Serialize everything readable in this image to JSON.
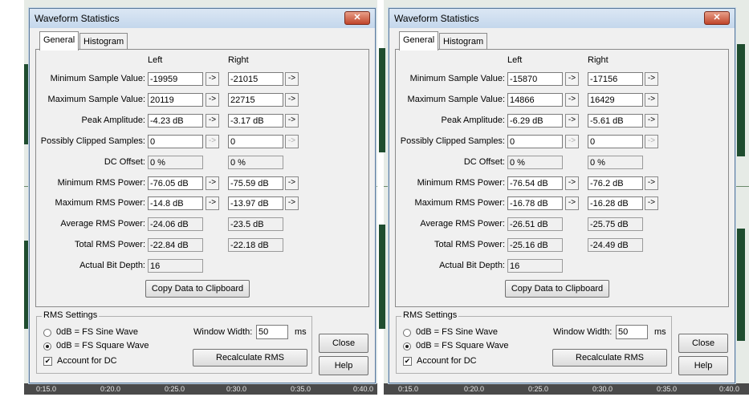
{
  "dialogs": [
    {
      "title": "Waveform Statistics",
      "close_glyph": "✕",
      "tabs": [
        "General",
        "Histogram"
      ],
      "col_left": "Left",
      "col_right": "Right",
      "rows": [
        {
          "label": "Minimum Sample Value:",
          "left": "-19959",
          "right": "-21015",
          "arrows": "on"
        },
        {
          "label": "Maximum Sample Value:",
          "left": "20119",
          "right": "22715",
          "arrows": "on"
        },
        {
          "label": "Peak Amplitude:",
          "left": "-4.23 dB",
          "right": "-3.17 dB",
          "arrows": "on"
        },
        {
          "label": "Possibly Clipped Samples:",
          "left": "0",
          "right": "0",
          "arrows": "disabled"
        },
        {
          "label": "DC Offset:",
          "left": "0 %",
          "right": "0 %",
          "arrows": "none"
        },
        {
          "label": "Minimum RMS Power:",
          "left": "-76.05 dB",
          "right": "-75.59 dB",
          "arrows": "on"
        },
        {
          "label": "Maximum RMS Power:",
          "left": "-14.8 dB",
          "right": "-13.97 dB",
          "arrows": "on"
        },
        {
          "label": "Average RMS Power:",
          "left": "-24.06 dB",
          "right": "-23.5 dB",
          "arrows": "none"
        },
        {
          "label": "Total RMS Power:",
          "left": "-22.84 dB",
          "right": "-22.18 dB",
          "arrows": "none"
        },
        {
          "label": "Actual Bit Depth:",
          "left": "16",
          "right": null,
          "arrows": "none"
        }
      ],
      "copy_button": "Copy Data to Clipboard",
      "rms_settings": {
        "title": "RMS Settings",
        "sine_label": "0dB = FS Sine Wave",
        "square_label": "0dB = FS Square Wave",
        "selected": "square",
        "dc_label": "Account for DC",
        "dc_checked": true,
        "window_width_label": "Window Width:",
        "window_width_value": "50",
        "window_width_unit": "ms",
        "recalc_button": "Recalculate RMS"
      },
      "close_button": "Close",
      "help_button": "Help"
    },
    {
      "title": "Waveform Statistics",
      "close_glyph": "✕",
      "tabs": [
        "General",
        "Histogram"
      ],
      "col_left": "Left",
      "col_right": "Right",
      "rows": [
        {
          "label": "Minimum Sample Value:",
          "left": "-15870",
          "right": "-17156",
          "arrows": "on"
        },
        {
          "label": "Maximum Sample Value:",
          "left": "14866",
          "right": "16429",
          "arrows": "on"
        },
        {
          "label": "Peak Amplitude:",
          "left": "-6.29 dB",
          "right": "-5.61 dB",
          "arrows": "on"
        },
        {
          "label": "Possibly Clipped Samples:",
          "left": "0",
          "right": "0",
          "arrows": "disabled"
        },
        {
          "label": "DC Offset:",
          "left": "0 %",
          "right": "0 %",
          "arrows": "none"
        },
        {
          "label": "Minimum RMS Power:",
          "left": "-76.54 dB",
          "right": "-76.2 dB",
          "arrows": "on"
        },
        {
          "label": "Maximum RMS Power:",
          "left": "-16.78 dB",
          "right": "-16.28 dB",
          "arrows": "on"
        },
        {
          "label": "Average RMS Power:",
          "left": "-26.51 dB",
          "right": "-25.75 dB",
          "arrows": "none"
        },
        {
          "label": "Total RMS Power:",
          "left": "-25.16 dB",
          "right": "-24.49 dB",
          "arrows": "none"
        },
        {
          "label": "Actual Bit Depth:",
          "left": "16",
          "right": null,
          "arrows": "none"
        }
      ],
      "copy_button": "Copy Data to Clipboard",
      "rms_settings": {
        "title": "RMS Settings",
        "sine_label": "0dB = FS Sine Wave",
        "square_label": "0dB = FS Square Wave",
        "selected": "square",
        "dc_label": "Account for DC",
        "dc_checked": true,
        "window_width_label": "Window Width:",
        "window_width_value": "50",
        "window_width_unit": "ms",
        "recalc_button": "Recalculate RMS"
      },
      "close_button": "Close",
      "help_button": "Help"
    }
  ],
  "arrow_glyph": "->",
  "timeline_left": [
    "0:15.0",
    "0:20.0",
    "0:25.0",
    "0:30.0",
    "0:35.0",
    "0:40.0"
  ],
  "timeline_right": [
    "0:15.0",
    "0:20.0",
    "0:25.0",
    "0:30.0",
    "0:35.0",
    "0:40.0"
  ],
  "colors": {
    "wave": "#1f4d2f",
    "title_gradient_top": "#dbe7f4",
    "close_red": "#c0442a"
  }
}
